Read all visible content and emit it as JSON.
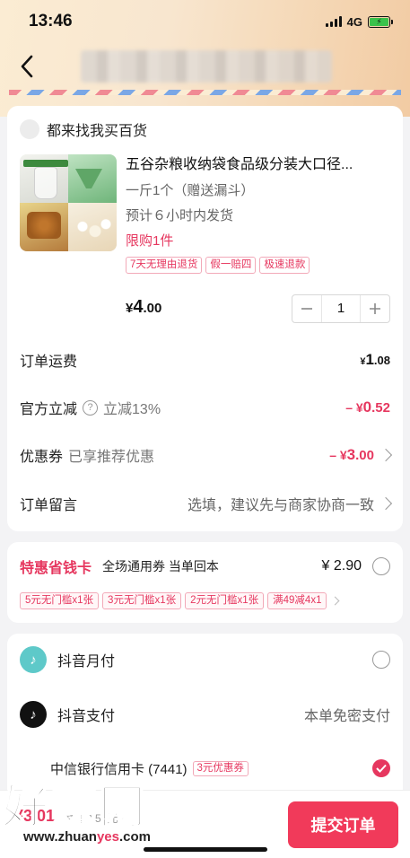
{
  "status": {
    "time": "13:46",
    "network": "4G"
  },
  "header": {
    "back_icon": "back-chevron-icon",
    "title_blurred": true
  },
  "order": {
    "shop_name": "都来找我买百货",
    "product": {
      "title": "五谷杂粮收纳袋食品级分装大口径...",
      "spec": "一斤1个（赠送漏斗）",
      "shipping": "预计６小时内发货",
      "limit": "限购1件",
      "tags": [
        "7天无理由退货",
        "假一赔四",
        "极速退款"
      ],
      "price": {
        "currency": "¥",
        "integer": "4",
        "decimal": ".00"
      },
      "quantity": "1"
    },
    "shipping_fee": {
      "label": "订单运费",
      "currency": "¥",
      "integer": "1",
      "decimal": ".08"
    },
    "official_discount": {
      "label": "官方立减",
      "sub": "立减13%",
      "value_prefix": "– ¥",
      "integer": "0",
      "decimal": ".52"
    },
    "coupon": {
      "label": "优惠券",
      "sub": "已享推荐优惠",
      "value_prefix": "– ¥",
      "integer": "3",
      "decimal": ".00"
    },
    "message": {
      "label": "订单留言",
      "placeholder": "选填，建议先与商家协商一致"
    }
  },
  "save_card": {
    "brand": "特惠省钱卡",
    "desc": "全场通用券 当单回本",
    "price": "¥ 2.90",
    "coupons": [
      "5元无门槛x1张",
      "3元无门槛x1张",
      "2元无门槛x1张",
      "满49减4x1"
    ]
  },
  "payment": {
    "monthly": {
      "label": "抖音月付"
    },
    "douyin_pay": {
      "label": "抖音支付",
      "note": "本单免密支付"
    },
    "bank": {
      "label": "中信银行信用卡 (7441)",
      "tag": "3元优惠券"
    }
  },
  "bottom": {
    "total": "¥3.01",
    "saved": "共减3.52元",
    "submit_label": "提交订单"
  },
  "watermark": {
    "brand": "好赚网",
    "url_a": "www.zhuan",
    "url_b": "yes",
    "url_c": ".com"
  },
  "colors": {
    "accent": "#e6375f",
    "submit": "#f13a5a",
    "tiktok_cyan": "#5ec9c9"
  }
}
